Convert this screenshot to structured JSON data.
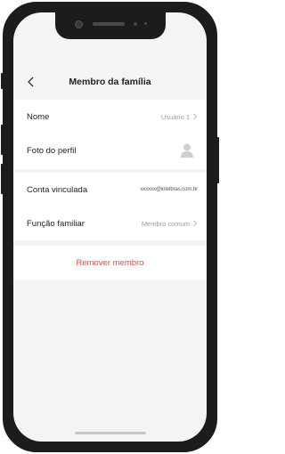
{
  "header": {
    "title": "Membro da família",
    "back_icon": "chevron-left-icon"
  },
  "profile_section": {
    "name_label": "Nome",
    "name_value": "Usuário 1",
    "photo_label": "Foto do perfil",
    "photo_icon": "user-avatar-icon"
  },
  "account_section": {
    "linked_label": "Conta vinculada",
    "linked_value": "xxxxxx@intelbras.com.br",
    "role_label": "Função familiar",
    "role_value": "Membro comum"
  },
  "actions": {
    "remove_label": "Remover membro"
  },
  "colors": {
    "background": "#f4f4f6",
    "card": "#ffffff",
    "danger": "#e64a4a",
    "muted": "#9a9a9a"
  }
}
